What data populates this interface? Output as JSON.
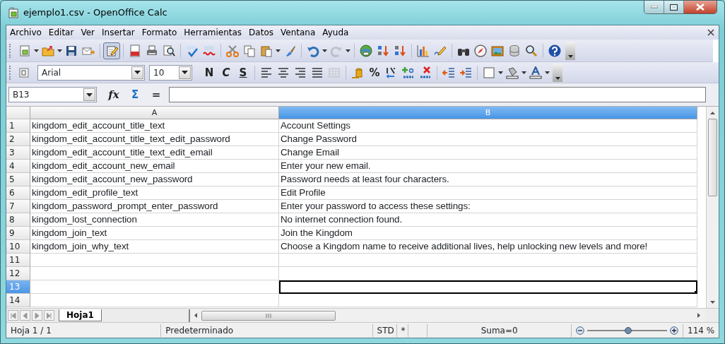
{
  "window": {
    "title": "ejemplo1.csv - OpenOffice Calc"
  },
  "menu": [
    {
      "label": "Archivo"
    },
    {
      "label": "Editar"
    },
    {
      "label": "Ver"
    },
    {
      "label": "Insertar"
    },
    {
      "label": "Formato"
    },
    {
      "label": "Herramientas"
    },
    {
      "label": "Datos"
    },
    {
      "label": "Ventana"
    },
    {
      "label": "Ayuda"
    }
  ],
  "standard_toolbar": {
    "edit_file_pressed": true,
    "redo_disabled": true
  },
  "formatting_toolbar": {
    "font_name": "Arial",
    "font_size": "10",
    "bold_label": "N",
    "italic_label": "C",
    "underline_label": "S",
    "percent_label": "%"
  },
  "formula_bar": {
    "name_box": "B13",
    "function_label": "fx",
    "sum_label": "Σ",
    "equals_label": "="
  },
  "columns": [
    {
      "label": "A",
      "selected": false
    },
    {
      "label": "B",
      "selected": true
    }
  ],
  "rows": [
    {
      "number": "1",
      "cells": [
        "kingdom_edit_account_title_text",
        "Account Settings"
      ],
      "selected": false
    },
    {
      "number": "2",
      "cells": [
        "kingdom_edit_account_title_text_edit_password",
        "Change Password"
      ],
      "selected": false
    },
    {
      "number": "3",
      "cells": [
        "kingdom_edit_account_title_text_edit_email",
        "Change Email"
      ],
      "selected": false
    },
    {
      "number": "4",
      "cells": [
        "kingdom_edit_account_new_email",
        "Enter your new email."
      ],
      "selected": false
    },
    {
      "number": "5",
      "cells": [
        "kingdom_edit_account_new_password",
        "Password needs at least four characters."
      ],
      "selected": false
    },
    {
      "number": "6",
      "cells": [
        "kingdom_edit_profile_text",
        "Edit Profile"
      ],
      "selected": false
    },
    {
      "number": "7",
      "cells": [
        "kingdom_password_prompt_enter_password",
        "Enter your password to access these settings:"
      ],
      "selected": false
    },
    {
      "number": "8",
      "cells": [
        "kingdom_lost_connection",
        "No internet connection found."
      ],
      "selected": false
    },
    {
      "number": "9",
      "cells": [
        "kingdom_join_text",
        "Join the Kingdom"
      ],
      "selected": false
    },
    {
      "number": "10",
      "cells": [
        "kingdom_join_why_text",
        "Choose a Kingdom name to receive additional lives, help unlocking new levels and more!"
      ],
      "selected": false
    },
    {
      "number": "11",
      "cells": [
        "",
        ""
      ],
      "selected": false
    },
    {
      "number": "12",
      "cells": [
        "",
        ""
      ],
      "selected": false
    },
    {
      "number": "13",
      "cells": [
        "",
        ""
      ],
      "selected": true
    },
    {
      "number": "14",
      "cells": [
        "",
        ""
      ],
      "selected": false
    }
  ],
  "sheet_tabs": [
    {
      "label": "Hoja1",
      "selected": true
    }
  ],
  "status_bar": {
    "sheet": "Hoja 1 / 1",
    "page_style": "Predeterminado",
    "selection_mode": "STD",
    "modified": "*",
    "sum": "Suma=0",
    "zoom": {
      "level": 0.51
    },
    "zoom_percent": "114 %"
  }
}
